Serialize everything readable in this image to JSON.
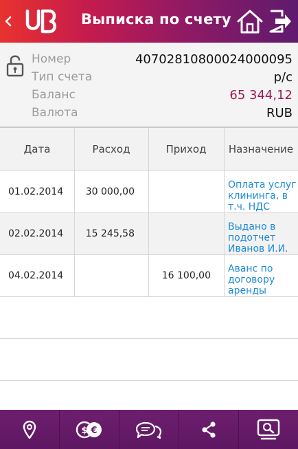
{
  "header": {
    "title": "Выписка по счету"
  },
  "account": {
    "fields": [
      {
        "label": "Номер",
        "value": "40702810800024000095"
      },
      {
        "label": "Тип счета",
        "value": "р/с"
      },
      {
        "label": "Баланс",
        "value": "65 344,12"
      },
      {
        "label": "Валюта",
        "value": "RUB"
      }
    ]
  },
  "table": {
    "headers": [
      "Дата",
      "Расход",
      "Приход",
      "Назначение"
    ],
    "rows": [
      {
        "date": "01.02.2014",
        "expense": "30 000,00",
        "income": "",
        "purpose": [
          "Оплата услуг",
          "клининга, в",
          "т.ч. НДС"
        ]
      },
      {
        "date": "02.02.2014",
        "expense": "15 245,58",
        "income": "",
        "purpose": [
          "Выдано в",
          "подотчет",
          "Иванов И.И."
        ]
      },
      {
        "date": "04.02.2014",
        "expense": "",
        "income": "16 100,00",
        "purpose": [
          "Аванс по",
          "договору",
          "аренды"
        ]
      }
    ]
  },
  "colors": {
    "header_start": "#e8322f",
    "header_end": "#5f1a6e",
    "balance": "#9c1c55",
    "link": "#1d8bd6",
    "nav": "#6d1f6f"
  },
  "icons": {
    "header": [
      "back-arrow-icon",
      "bank-logo-icon",
      "home-icon",
      "exit-icon"
    ],
    "account": [
      "lock-open-icon"
    ],
    "nav": [
      "location-pin-icon",
      "currency-exchange-icon",
      "chat-icon",
      "share-icon",
      "search-screen-icon"
    ]
  }
}
